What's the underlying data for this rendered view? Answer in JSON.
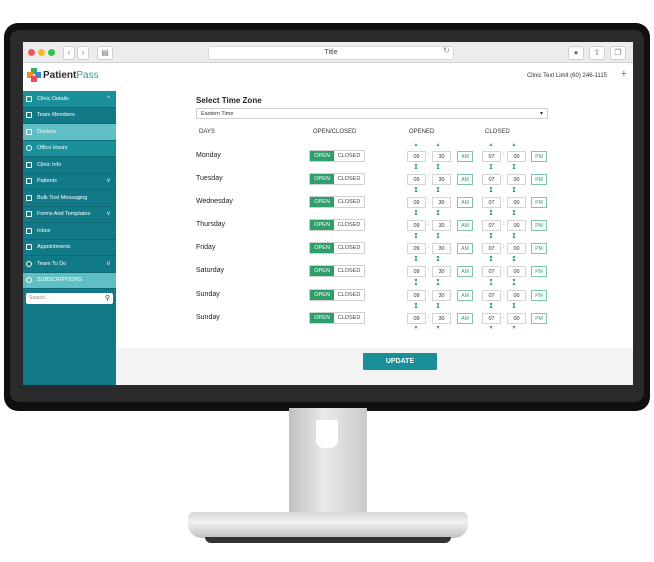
{
  "browser": {
    "title": "Title"
  },
  "app": {
    "logo_patient": "Patient",
    "logo_pass": "Pass",
    "text_limit": "Clinic Text Limit (60) 246-1115",
    "plus": "+"
  },
  "sidebar": {
    "items": [
      {
        "label": "Clinic Details",
        "caret": "^"
      },
      {
        "label": "Team Members",
        "caret": ""
      },
      {
        "label": "Doctors",
        "caret": ""
      },
      {
        "label": "Office Hours",
        "caret": ""
      },
      {
        "label": "Clinic Info",
        "caret": ""
      },
      {
        "label": "Patients",
        "caret": "v"
      },
      {
        "label": "Bulk Text Messaging",
        "caret": ""
      },
      {
        "label": "Forms And Templates",
        "caret": "v"
      },
      {
        "label": "Inbox",
        "caret": ""
      },
      {
        "label": "Appointments",
        "caret": ""
      },
      {
        "label": "Team To Do",
        "caret": "v"
      },
      {
        "label": "SUBSCRIPTIONS",
        "caret": ""
      }
    ],
    "search_placeholder": "Search..."
  },
  "main": {
    "tz_label": "Select Time Zone",
    "tz_value": "Eastern Time",
    "headers": {
      "days": "DAYS",
      "open_closed": "OPEN/CLOSED",
      "opened": "OPENED",
      "closed": "CLOSED"
    },
    "rows": [
      {
        "day": "Monday",
        "open": "OPEN",
        "closed": "CLOSED",
        "oh": "09",
        "om": "30",
        "oap": "AM",
        "ch": "07",
        "cm": "00",
        "cap": "PM"
      },
      {
        "day": "Tuesday",
        "open": "OPEN",
        "closed": "CLOSED",
        "oh": "09",
        "om": "30",
        "oap": "AM",
        "ch": "07",
        "cm": "00",
        "cap": "PM"
      },
      {
        "day": "Wednesday",
        "open": "OPEN",
        "closed": "CLOSED",
        "oh": "09",
        "om": "30",
        "oap": "AM",
        "ch": "07",
        "cm": "00",
        "cap": "PM"
      },
      {
        "day": "Thursday",
        "open": "OPEN",
        "closed": "CLOSED",
        "oh": "09",
        "om": "30",
        "oap": "AM",
        "ch": "07",
        "cm": "00",
        "cap": "PM"
      },
      {
        "day": "Friday",
        "open": "OPEN",
        "closed": "CLOSED",
        "oh": "09",
        "om": "30",
        "oap": "AM",
        "ch": "07",
        "cm": "00",
        "cap": "PM"
      },
      {
        "day": "Saturday",
        "open": "OPEN",
        "closed": "CLOSED",
        "oh": "09",
        "om": "30",
        "oap": "AM",
        "ch": "07",
        "cm": "00",
        "cap": "PM"
      },
      {
        "day": "Sunday",
        "open": "OPEN",
        "closed": "CLOSED",
        "oh": "09",
        "om": "30",
        "oap": "AM",
        "ch": "07",
        "cm": "00",
        "cap": "PM"
      },
      {
        "day": "Sunday",
        "open": "OPEN",
        "closed": "CLOSED",
        "oh": "09",
        "om": "30",
        "oap": "AM",
        "ch": "07",
        "cm": "00",
        "cap": "PM"
      }
    ],
    "update_label": "UPDATE"
  },
  "colors": {
    "teal": "#127a86",
    "green": "#2e9e6c",
    "update": "#1a8f99"
  }
}
